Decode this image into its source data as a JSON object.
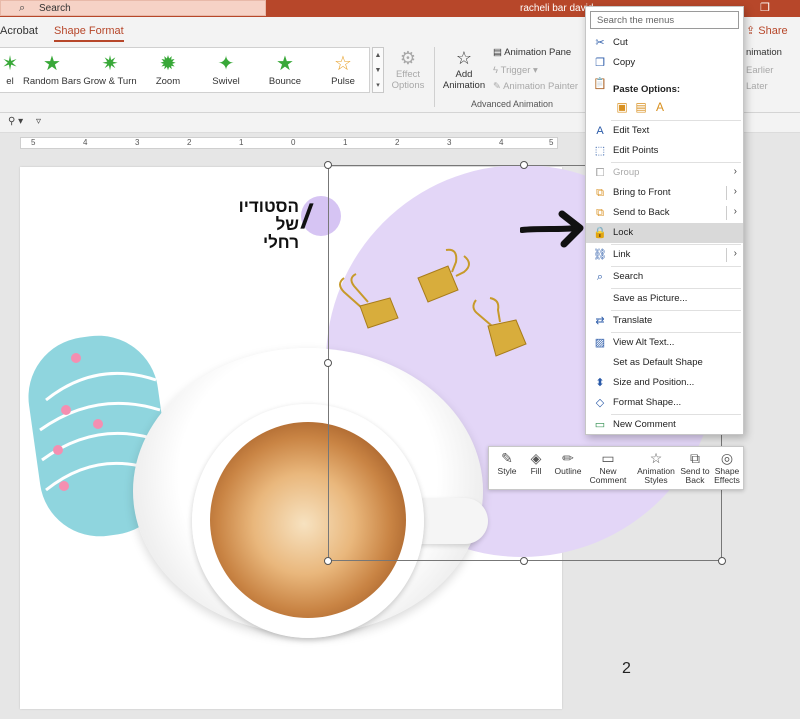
{
  "titlebar": {
    "search_placeholder": "Search",
    "user_name": "racheli bar david",
    "restore_glyph": "❐"
  },
  "tabs": [
    {
      "label": "Acrobat",
      "active": false
    },
    {
      "label": "Shape Format",
      "active": true
    }
  ],
  "share_label": "Share",
  "animations": [
    {
      "label": "el"
    },
    {
      "label": "Random Bars"
    },
    {
      "label": "Grow & Turn"
    },
    {
      "label": "Zoom"
    },
    {
      "label": "Swivel"
    },
    {
      "label": "Bounce"
    },
    {
      "label": "Pulse"
    }
  ],
  "ribbon": {
    "effect_options": "Effect Options",
    "add_animation": "Add Animation",
    "animation_pane": "Animation Pane",
    "trigger": "Trigger",
    "animation_painter": "Animation Painter",
    "advanced_animation": "Advanced Animation",
    "right_labels": [
      "nimation",
      "Earlier",
      "Later"
    ]
  },
  "ruler_labels": [
    "5",
    "4",
    "3",
    "2",
    "1",
    "0",
    "1",
    "2",
    "3",
    "4",
    "5"
  ],
  "slide": {
    "logo_line1": "הסטודיו",
    "logo_line2": "של רחלי",
    "page_number": "2"
  },
  "minibar": [
    {
      "label": "Style",
      "icon": "style-icon"
    },
    {
      "label": "Fill",
      "icon": "fill-icon"
    },
    {
      "label": "Outline",
      "icon": "outline-icon"
    },
    {
      "label": "New Comment",
      "icon": "comment-icon"
    },
    {
      "label": "Animation Styles",
      "icon": "animation-styles-icon"
    },
    {
      "label": "Send to Back",
      "icon": "send-to-back-icon"
    },
    {
      "label": "Shape Effects",
      "icon": "shape-effects-icon"
    }
  ],
  "context_menu": {
    "search_placeholder": "Search the menus",
    "cut": "Cut",
    "copy": "Copy",
    "paste_options": "Paste Options:",
    "edit_text": "Edit Text",
    "edit_points": "Edit Points",
    "group": "Group",
    "bring_to_front": "Bring to Front",
    "send_to_back": "Send to Back",
    "lock": "Lock",
    "link": "Link",
    "search": "Search",
    "save_as_picture": "Save as Picture...",
    "translate": "Translate",
    "view_alt_text": "View Alt Text...",
    "set_default_shape": "Set as Default Shape",
    "size_and_position": "Size and Position...",
    "format_shape": "Format Shape...",
    "new_comment": "New Comment"
  }
}
